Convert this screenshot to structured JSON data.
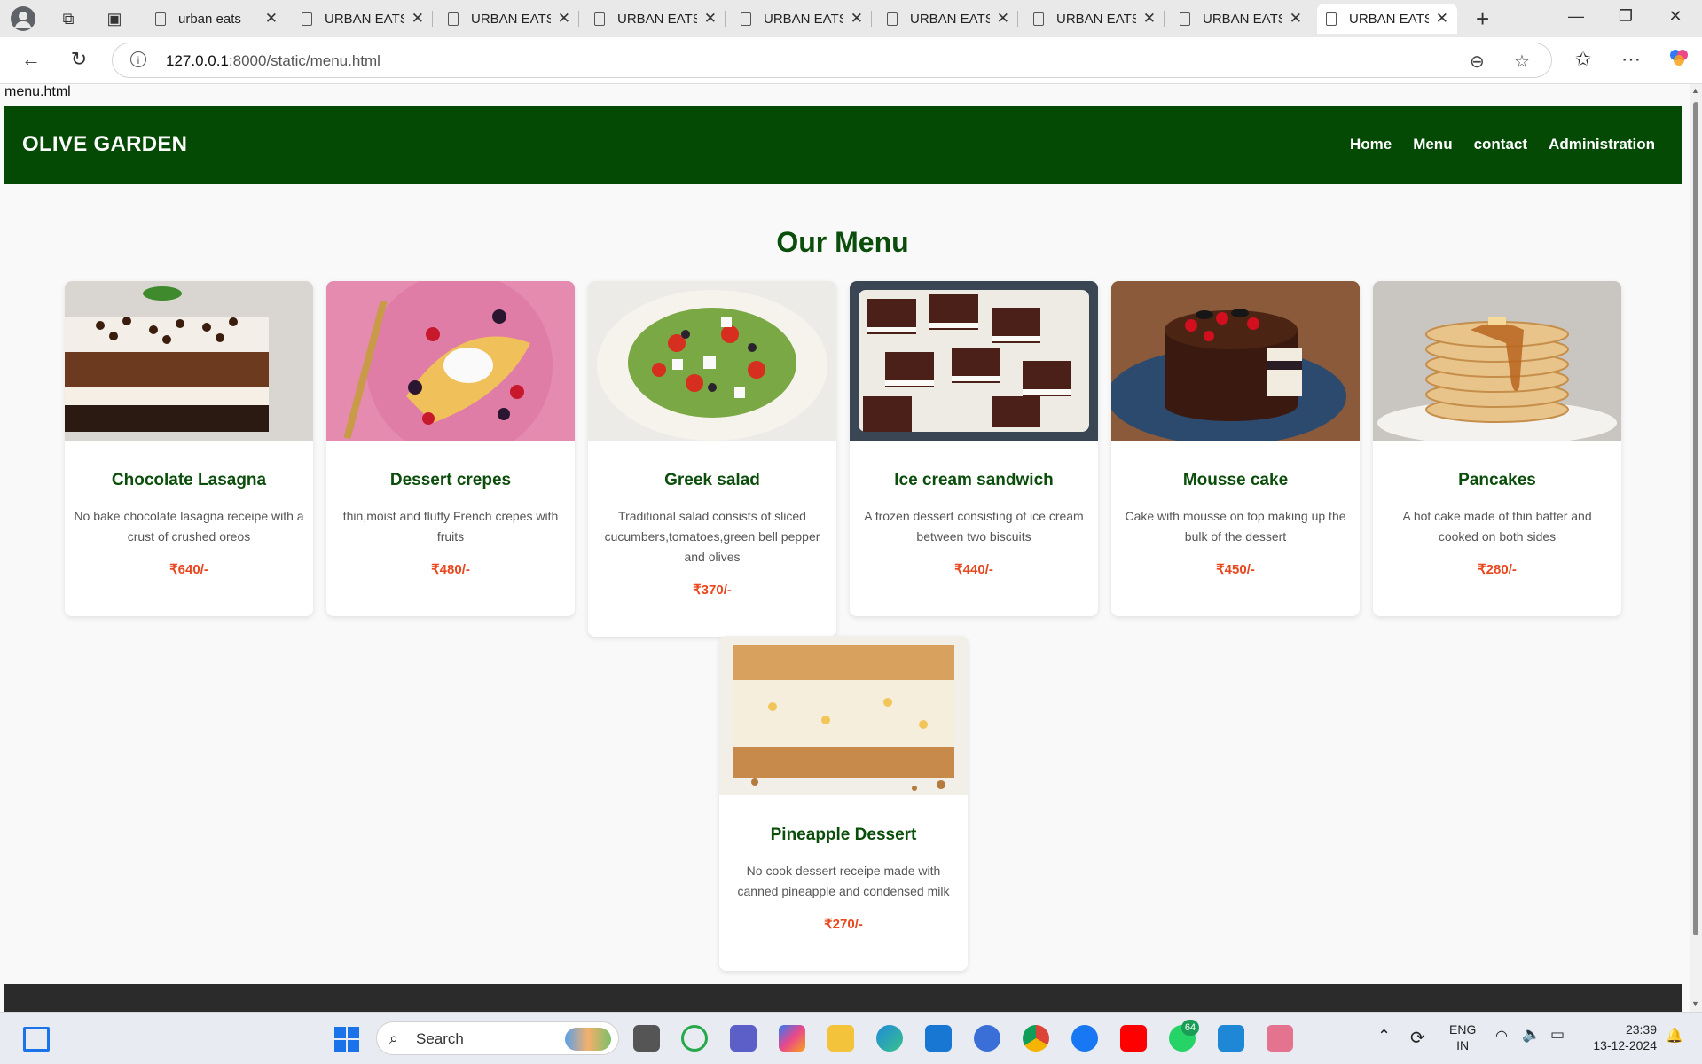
{
  "browser": {
    "tabs": [
      {
        "title": "urban eats"
      },
      {
        "title": "URBAN EATS"
      },
      {
        "title": "URBAN EATS"
      },
      {
        "title": "URBAN EATS"
      },
      {
        "title": "URBAN EATS"
      },
      {
        "title": "URBAN EATS"
      },
      {
        "title": "URBAN EATS"
      },
      {
        "title": "URBAN EATS"
      },
      {
        "title": "URBAN EATS"
      }
    ],
    "url_host": "127.0.0.1",
    "url_path": ":8000/static/menu.html"
  },
  "page": {
    "filename": "menu.html",
    "brand": "OLIVE GARDEN",
    "nav": [
      "Home",
      "Menu",
      "contact",
      "Administration"
    ],
    "heading": "Our Menu",
    "items": [
      {
        "name": "Chocolate Lasagna",
        "desc": "No bake chocolate lasagna receipe with a crust of crushed oreos",
        "price": "₹640/-"
      },
      {
        "name": "Dessert crepes",
        "desc": "thin,moist and fluffy French crepes with fruits",
        "price": "₹480/-"
      },
      {
        "name": "Greek salad",
        "desc": "Traditional salad consists of sliced cucumbers,tomatoes,green bell pepper and olives",
        "price": "₹370/-"
      },
      {
        "name": "Ice cream sandwich",
        "desc": "A frozen dessert consisting of ice cream between two biscuits",
        "price": "₹440/-"
      },
      {
        "name": "Mousse cake",
        "desc": "Cake with mousse on top making up the bulk of the dessert",
        "price": "₹450/-"
      },
      {
        "name": "Pancakes",
        "desc": "A hot cake made of thin batter and cooked on both sides",
        "price": "₹280/-"
      },
      {
        "name": "Pineapple Dessert",
        "desc": "No cook dessert receipe made with canned pineapple and condensed milk",
        "price": "₹270/-"
      }
    ]
  },
  "taskbar": {
    "search_label": "Search",
    "whatsapp_badge": "64",
    "lang": "ENG",
    "region": "IN",
    "time": "23:39",
    "date": "13-12-2024"
  },
  "colors": {
    "header_green": "#044a04",
    "heading_green": "#0b4d0b",
    "price_orange": "#e8481f",
    "footer_dark": "#2b2b2b"
  }
}
